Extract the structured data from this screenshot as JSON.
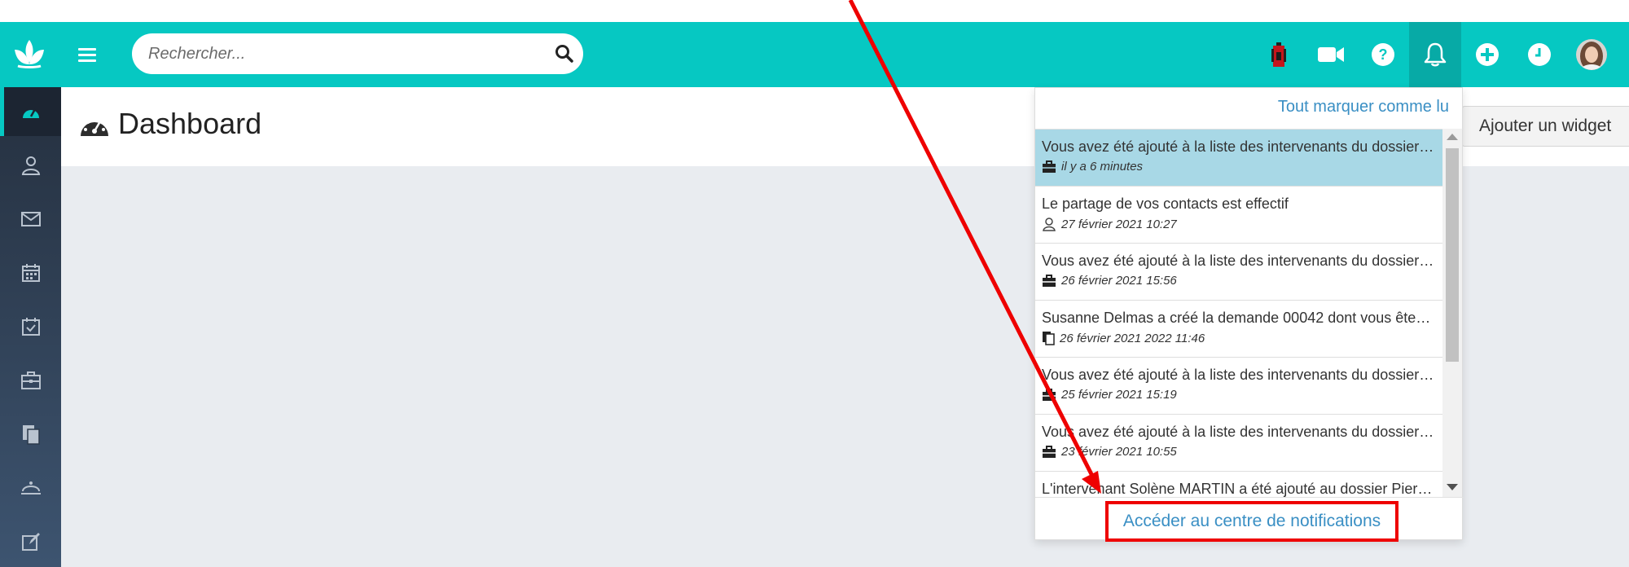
{
  "app": {
    "colors": {
      "accent": "#06c8c2",
      "link": "#3a8fc4",
      "highlight": "#a8d8e6",
      "annotation": "#ee0000"
    }
  },
  "topbar": {
    "search_placeholder": "Rechercher...",
    "icons": [
      "logo-icon",
      "menu-icon",
      "search-icon",
      "battery-icon",
      "video-icon",
      "help-icon",
      "bell-icon",
      "plus-icon",
      "clock-icon",
      "avatar"
    ]
  },
  "sidebar": {
    "items": [
      "dashboard-icon",
      "contacts-icon",
      "mail-icon",
      "calendar-icon",
      "tasks-icon",
      "briefcase-icon",
      "documents-icon",
      "reception-icon",
      "edit-icon"
    ]
  },
  "main": {
    "title": "Dashboard",
    "add_widget_label": "Ajouter un widget"
  },
  "notifications": {
    "mark_all_read": "Tout marquer comme lu",
    "footer_link": "Accéder au centre de notifications",
    "items": [
      {
        "title": "Vous avez été ajouté à la liste des intervenants du dossier…",
        "time": "il y a 6 minutes",
        "icon": "briefcase-icon",
        "highlight": true
      },
      {
        "title": "Le partage de vos contacts est effectif",
        "time": "27 février 2021 10:27",
        "icon": "contacts-icon",
        "highlight": false
      },
      {
        "title": "Vous avez été ajouté à la liste des intervenants du dossier…",
        "time": "26 février 2021 15:56",
        "icon": "briefcase-icon",
        "highlight": false
      },
      {
        "title": "Susanne Delmas a créé la demande 00042 dont vous ête…",
        "time": "26 février 2021 2022 11:46",
        "icon": "documents-icon",
        "highlight": false
      },
      {
        "title": "Vous avez été ajouté à la liste des intervenants du dossier…",
        "time": "25 février 2021 15:19",
        "icon": "briefcase-icon",
        "highlight": false
      },
      {
        "title": "Vous avez été ajouté à la liste des intervenants du dossier…",
        "time": "23 février 2021 10:55",
        "icon": "briefcase-icon",
        "highlight": false
      },
      {
        "title": "L'intervenant Solène MARTIN a été ajouté au dossier Pier…",
        "time": "",
        "icon": "briefcase-icon",
        "highlight": false
      }
    ]
  }
}
